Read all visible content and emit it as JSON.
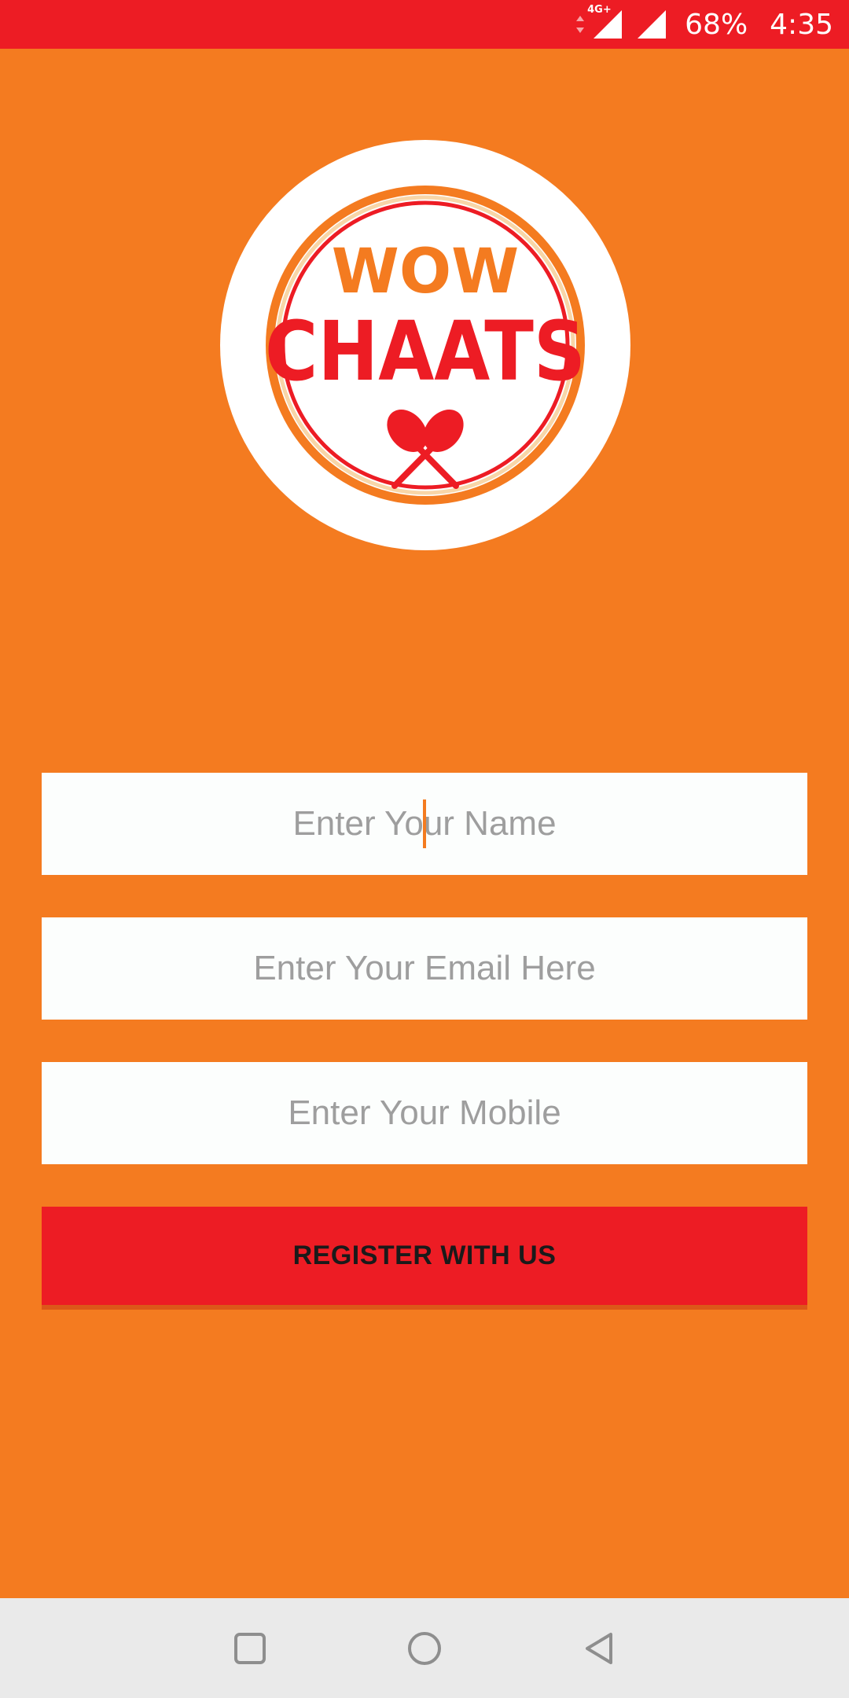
{
  "status_bar": {
    "network_type": "4G+",
    "battery": "68%",
    "time": "4:35",
    "icons": [
      "data-arrows-icon",
      "signal-4g-icon",
      "signal-icon"
    ],
    "background_color": "#ED1C24"
  },
  "logo": {
    "line1": "WOW",
    "line2": "CHAATS",
    "icon": "crossed-spoons-icon",
    "colors": {
      "orange": "#F47B20",
      "red": "#ED1C24",
      "white": "#FFFFFF"
    }
  },
  "form": {
    "name_placeholder": "Enter Your Name",
    "email_placeholder": "Enter Your Email Here",
    "mobile_placeholder": "Enter Your Mobile",
    "name_value": "",
    "email_value": "",
    "mobile_value": "",
    "register_label": "REGISTER WITH US"
  },
  "nav_bar": {
    "icons": [
      "recent-apps-icon",
      "home-icon",
      "back-icon"
    ]
  },
  "theme": {
    "background": "#F47B20",
    "accent_red": "#ED1C24",
    "field_bg": "#FCFEFD",
    "placeholder_color": "#9E9E9E"
  }
}
